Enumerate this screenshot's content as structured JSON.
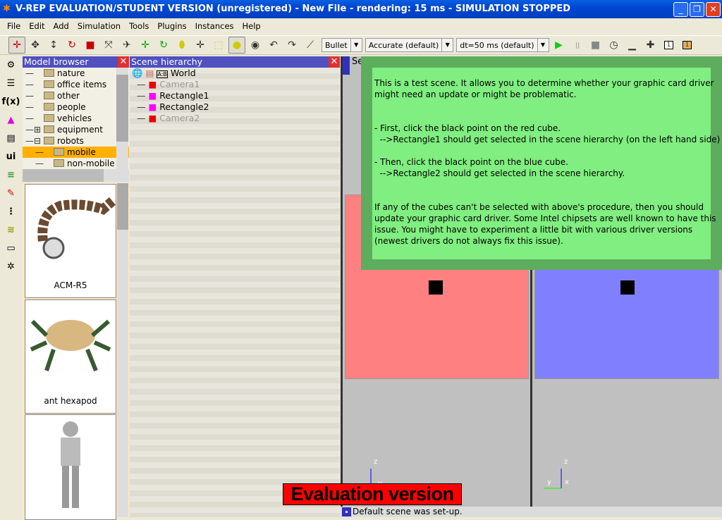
{
  "window": {
    "title": "V-REP EVALUATION/STUDENT VERSION (unregistered) - New File - rendering: 15 ms - SIMULATION STOPPED"
  },
  "menu": [
    "File",
    "Edit",
    "Add",
    "Simulation",
    "Tools",
    "Plugins",
    "Instances",
    "Help"
  ],
  "toolbar": {
    "engine": "Bullet",
    "accuracy": "Accurate (default)",
    "dt": "dt=50 ms (default)",
    "page1": "1",
    "page2": "1"
  },
  "model_browser": {
    "title": "Model browser",
    "tree": [
      {
        "label": "nature",
        "prefix": "—",
        "indent": 0
      },
      {
        "label": "office items",
        "prefix": "—",
        "indent": 0
      },
      {
        "label": "other",
        "prefix": "—",
        "indent": 0
      },
      {
        "label": "people",
        "prefix": "—",
        "indent": 0
      },
      {
        "label": "vehicles",
        "prefix": "—",
        "indent": 0
      },
      {
        "label": "equipment",
        "prefix": "—⊞",
        "indent": 0
      },
      {
        "label": "robots",
        "prefix": "—⊟",
        "indent": 0
      },
      {
        "label": "mobile",
        "prefix": "—",
        "indent": 1,
        "selected": true
      },
      {
        "label": "non-mobile",
        "prefix": "—",
        "indent": 1
      }
    ],
    "thumbnails": [
      "ACM-R5",
      "ant hexapod",
      ""
    ]
  },
  "scene_hierarchy": {
    "title": "Scene hierarchy",
    "items": [
      {
        "label": "World",
        "type": "world",
        "enabled": true
      },
      {
        "label": "Camera1",
        "type": "camera",
        "enabled": false
      },
      {
        "label": "Rectangle1",
        "type": "shape",
        "enabled": true
      },
      {
        "label": "Rectangle2",
        "type": "shape",
        "enabled": true
      },
      {
        "label": "Camera2",
        "type": "camera",
        "enabled": false
      }
    ]
  },
  "viewport": {
    "label": "Se",
    "cube_colors": [
      "#ff8080",
      "#8080ff"
    ],
    "info_text": "This is a test scene. It allows you to determine whether your graphic card driver\nmight need an update or might be problematic.\n\n\n- First, click the black point on the red cube.\n  -->Rectangle1 should get selected in the scene hierarchy (on the left hand side)\n\n- Then, click the black point on the blue cube.\n  -->Rectangle2 should get selected in the scene hierarchy.\n\n\nIf any of the cubes can't be selected with above's procedure, then you should\nupdate your graphic card driver. Some Intel chipsets are well known to have this\nissue. You might have to experiment a little bit with various driver versions\n(newest drivers do not always fix this issue).",
    "axes": {
      "z": "z",
      "y": "y",
      "x": "x"
    }
  },
  "eval_badge": "Evaluation version",
  "status": "Default scene was set-up."
}
